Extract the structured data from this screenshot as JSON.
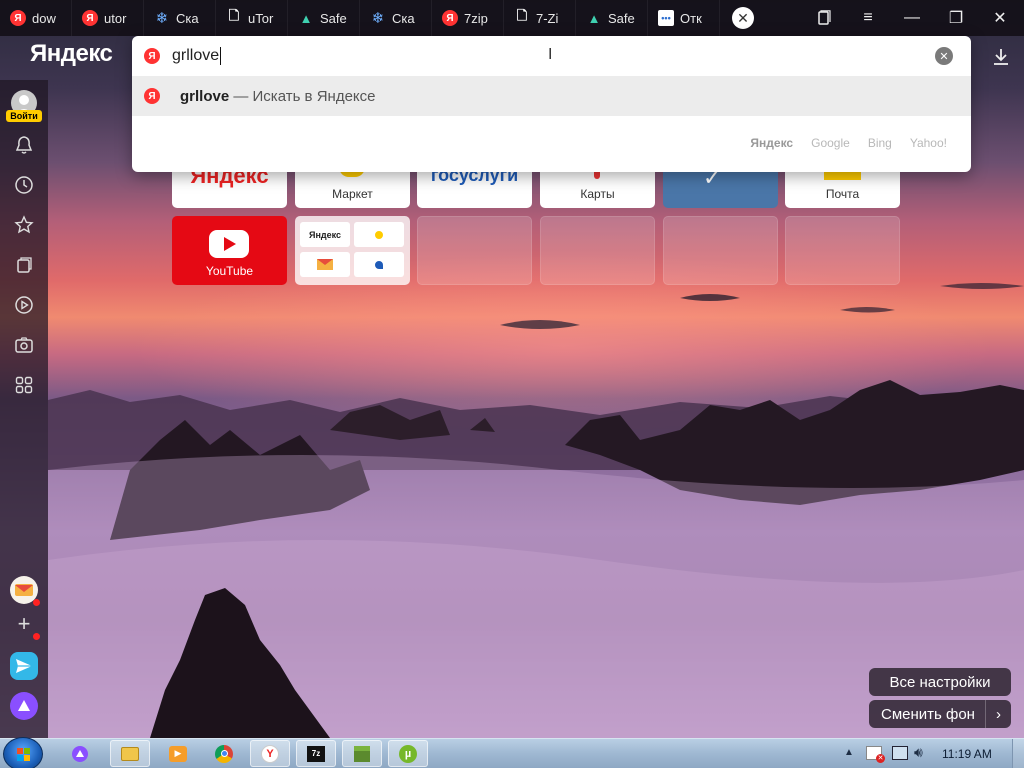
{
  "tabs": [
    {
      "title": "dow",
      "favicon": "yandex-icon"
    },
    {
      "title": "utor",
      "favicon": "yandex-icon"
    },
    {
      "title": "Ска",
      "favicon": "snowflake-icon"
    },
    {
      "title": "uTor",
      "favicon": "document-icon"
    },
    {
      "title": "Safe",
      "favicon": "triangle-icon"
    },
    {
      "title": "Ска",
      "favicon": "snowflake-icon"
    },
    {
      "title": "7zip",
      "favicon": "yandex-icon"
    },
    {
      "title": "7-Zi",
      "favicon": "document-icon"
    },
    {
      "title": "Safe",
      "favicon": "triangle-icon"
    },
    {
      "title": "Отк",
      "favicon": "dots-icon"
    }
  ],
  "header": {
    "logo": "Яндекс"
  },
  "omnibox": {
    "value": "grllove",
    "suggestion_query": "grllove",
    "suggestion_rest": " — Искать в Яндексе",
    "engines": [
      "Яндекс",
      "Google",
      "Bing",
      "Yahoo!"
    ]
  },
  "sidebar": {
    "login_label": "Войти"
  },
  "tiles": {
    "row1": [
      {
        "label": "",
        "name": "yandex"
      },
      {
        "label": "Маркет",
        "name": "market"
      },
      {
        "label": "",
        "name": "gosuslugi"
      },
      {
        "label": "Карты",
        "name": "maps"
      },
      {
        "label": "",
        "name": "vk"
      },
      {
        "label": "Почта",
        "name": "mail"
      }
    ],
    "youtube_label": "YouTube",
    "group_logo": "Яндекс",
    "yandex_tile_text": "Яндекс",
    "gosuslugi_text": "госуслуги"
  },
  "bottom": {
    "settings_label": "Все настройки",
    "change_bg_label": "Сменить фон"
  },
  "taskbar": {
    "time": "11:19 AM"
  },
  "colors": {
    "accent_red": "#ff3333",
    "youtube_red": "#e50914",
    "vk_blue": "#4a76a8",
    "taskbar": "#9fb8d2"
  }
}
